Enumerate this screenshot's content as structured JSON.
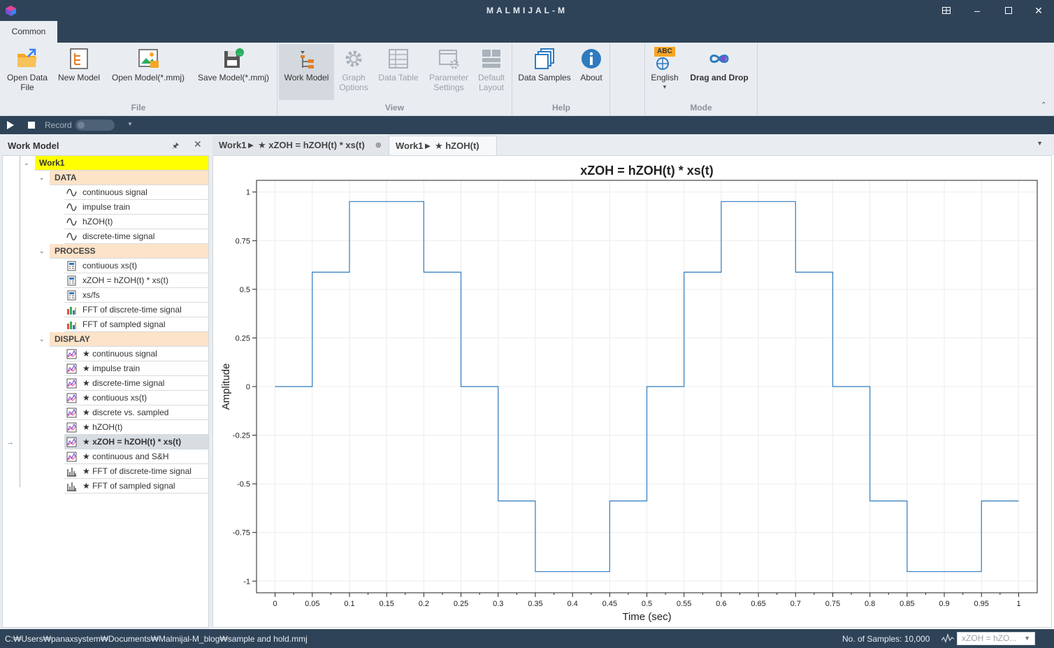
{
  "app": {
    "title": "MALMIJAL-M"
  },
  "ribbon": {
    "tab": "Common",
    "file_group": {
      "label": "File",
      "open_data_file_line1": "Open Data",
      "open_data_file_line2": "File",
      "new_model": "New Model",
      "open_model": "Open Model(*.mmj)",
      "save_model": "Save Model(*.mmj)"
    },
    "view_group": {
      "label": "View",
      "work_model": "Work Model",
      "graph_options_line1": "Graph",
      "graph_options_line2": "Options",
      "data_table": "Data Table",
      "parameter_settings_line1": "Parameter",
      "parameter_settings_line2": "Settings",
      "default_layout_line1": "Default",
      "default_layout_line2": "Layout"
    },
    "help_group": {
      "label": "Help",
      "data_samples": "Data Samples",
      "about": "About"
    },
    "mode_group": {
      "label": "Mode",
      "language": "English",
      "drag_and_drop": "Drag and Drop",
      "abc_badge": "ABC"
    }
  },
  "record_bar": {
    "record_label": "Record"
  },
  "left_panel": {
    "title": "Work Model",
    "root": "Work1",
    "categories": [
      {
        "label": "DATA",
        "items": [
          {
            "label": "continuous signal",
            "icon": "wave-icon"
          },
          {
            "label": "impulse train",
            "icon": "wave-icon"
          },
          {
            "label": "hZOH(t)",
            "icon": "wave-icon"
          },
          {
            "label": "discrete-time signal",
            "icon": "wave-icon"
          }
        ]
      },
      {
        "label": "PROCESS",
        "items": [
          {
            "label": "contiuous xs(t)",
            "icon": "calculator-icon"
          },
          {
            "label": "xZOH = hZOH(t) * xs(t)",
            "icon": "calculator-icon"
          },
          {
            "label": "xs/fs",
            "icon": "calculator-icon"
          },
          {
            "label": "FFT of discrete-time signal",
            "icon": "bar-chart-icon"
          },
          {
            "label": "FFT of sampled signal",
            "icon": "bar-chart-icon"
          }
        ]
      },
      {
        "label": "DISPLAY",
        "items": [
          {
            "label": "★ continuous signal",
            "icon": "line-graph-icon"
          },
          {
            "label": "★ impulse train",
            "icon": "line-graph-icon"
          },
          {
            "label": "★ discrete-time signal",
            "icon": "line-graph-icon"
          },
          {
            "label": "★ contiuous xs(t)",
            "icon": "line-graph-icon"
          },
          {
            "label": "★ discrete vs. sampled",
            "icon": "line-graph-icon"
          },
          {
            "label": "★ hZOH(t)",
            "icon": "line-graph-icon"
          },
          {
            "label": "★ xZOH = hZOH(t) * xs(t)",
            "icon": "line-graph-icon",
            "selected": true
          },
          {
            "label": "★ continuous and S&H",
            "icon": "line-graph-icon"
          },
          {
            "label": "★ FFT of discrete-time signal",
            "icon": "stem-chart-icon"
          },
          {
            "label": "★ FFT of sampled signal",
            "icon": "stem-chart-icon"
          }
        ]
      }
    ]
  },
  "doc_tabs": [
    {
      "label": "Work1► ★ xZOH = hZOH(t) * xs(t)",
      "active": true,
      "closable": true
    },
    {
      "label": "Work1► ★ hZOH(t)",
      "active": false,
      "closable": false
    }
  ],
  "chart_data": {
    "type": "line",
    "title": "xZOH = hZOH(t) * xs(t)",
    "xlabel": "Time (sec)",
    "ylabel": "Amplitude",
    "xlim": [
      -0.025,
      1.025
    ],
    "ylim": [
      -1.06,
      1.06
    ],
    "xticks": [
      "0",
      "0.05",
      "0.1",
      "0.15",
      "0.2",
      "0.25",
      "0.3",
      "0.35",
      "0.4",
      "0.45",
      "0.5",
      "0.55",
      "0.6",
      "0.65",
      "0.7",
      "0.75",
      "0.8",
      "0.85",
      "0.9",
      "0.95",
      "1"
    ],
    "yticks": [
      "1",
      "0.75",
      "0.5",
      "0.25",
      "0",
      "-0.25",
      "-0.5",
      "-0.75",
      "-1"
    ],
    "grid": true,
    "line_color": "#2f7bbf",
    "step": true,
    "x": [
      0,
      0.05,
      0.1,
      0.15,
      0.2,
      0.25,
      0.3,
      0.35,
      0.4,
      0.45,
      0.5,
      0.55,
      0.6,
      0.65,
      0.7,
      0.75,
      0.8,
      0.85,
      0.9,
      0.95,
      1.0
    ],
    "y": [
      0,
      0.588,
      0.951,
      0.951,
      0.588,
      0,
      -0.588,
      -0.951,
      -0.951,
      -0.588,
      0,
      0.588,
      0.951,
      0.951,
      0.588,
      0,
      -0.588,
      -0.951,
      -0.951,
      -0.588,
      -0.588
    ]
  },
  "status_bar": {
    "path": "C:₩Users₩panaxsystem₩Documents₩Malmijal-M_blog₩sample and hold.mmj",
    "samples": "No. of Samples: 10,000",
    "selected_display": "xZOH = hZO..."
  }
}
